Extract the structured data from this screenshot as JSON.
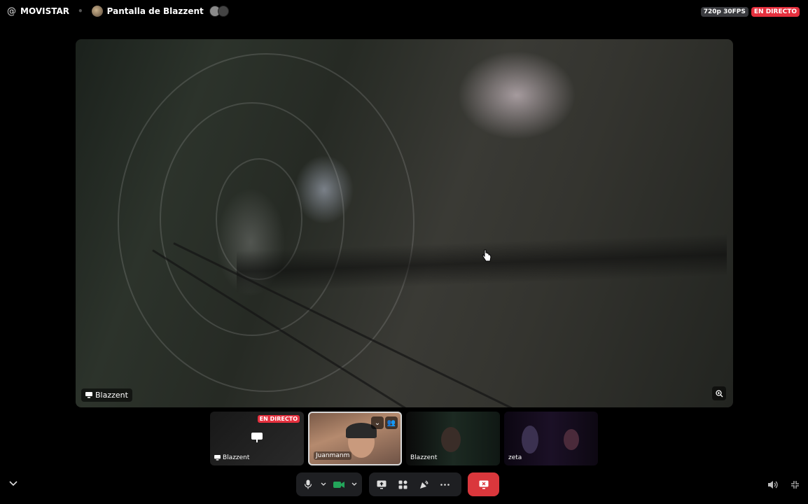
{
  "topbar": {
    "channel_type_icon": "at-icon",
    "channel_name": "MOVISTAR",
    "screen_title": "Pantalla de Blazzent",
    "quality": "720p 30FPS",
    "live": "EN DIRECTO"
  },
  "stage": {
    "streamer_label": "Blazzent"
  },
  "tiles": [
    {
      "name": "Blazzent",
      "live": "EN DIRECTO"
    },
    {
      "name": "Juanmanm"
    },
    {
      "name": "Blazzent"
    },
    {
      "name": "zeta"
    }
  ],
  "colors": {
    "live_red": "#e5303e",
    "hangup_red": "#da373c",
    "camera_green": "#23a55a",
    "control_bg": "#1e1f22"
  }
}
